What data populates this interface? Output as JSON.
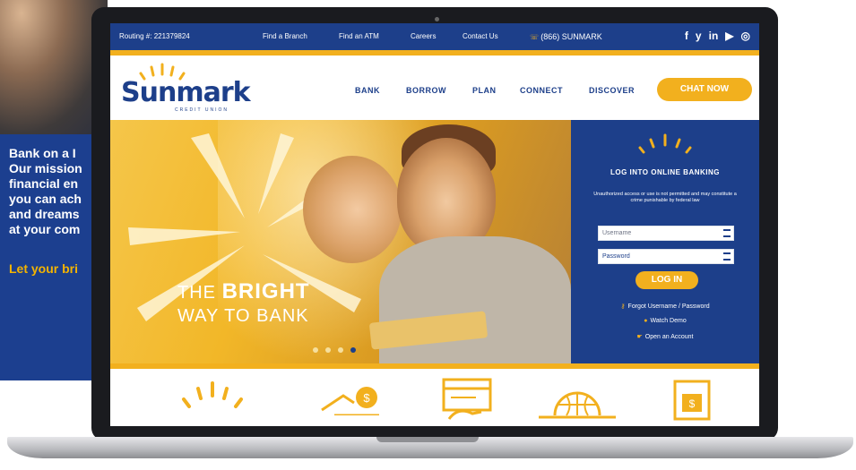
{
  "poster": {
    "lines": [
      "Bank on a I",
      "Our mission",
      "financial en",
      "you can ach",
      "and dreams",
      "at your com"
    ],
    "cta": "Let your bri"
  },
  "topbar": {
    "routing": "Routing #: 221379824",
    "find_branch": "Find a Branch",
    "find_atm": "Find an ATM",
    "careers": "Careers",
    "contact": "Contact Us",
    "phone": "(866) SUNMARK",
    "social": [
      "f",
      "y",
      "in",
      "▶",
      "◎"
    ]
  },
  "brand": {
    "name": "Sunmark",
    "sub": "CREDIT UNION"
  },
  "nav": {
    "items": [
      "BANK",
      "BORROW",
      "PLAN",
      "CONNECT",
      "DISCOVER"
    ],
    "chat": "CHAT NOW"
  },
  "hero": {
    "title_line1_a": "THE",
    "title_line1_b": "BRIGHT",
    "title_line2": "WAY TO BANK",
    "slide_count": 4,
    "active_slide": 4
  },
  "login": {
    "title": "LOG INTO ONLINE BANKING",
    "note": "Unauthorized access or use is not permitted and may constitute a crime punishable by federal law",
    "username_placeholder": "Username",
    "password_placeholder": "Password",
    "button": "LOG IN",
    "forgot": "Forgot Username / Password",
    "demo": "Watch Demo",
    "open": "Open an Account"
  },
  "colors": {
    "brand_blue": "#1d3f8a",
    "brand_yellow": "#f2b01e"
  },
  "icons": [
    "sun-icon",
    "house-dollar-icon",
    "card-hand-icon",
    "globe-icon",
    "phone-dollar-icon"
  ]
}
